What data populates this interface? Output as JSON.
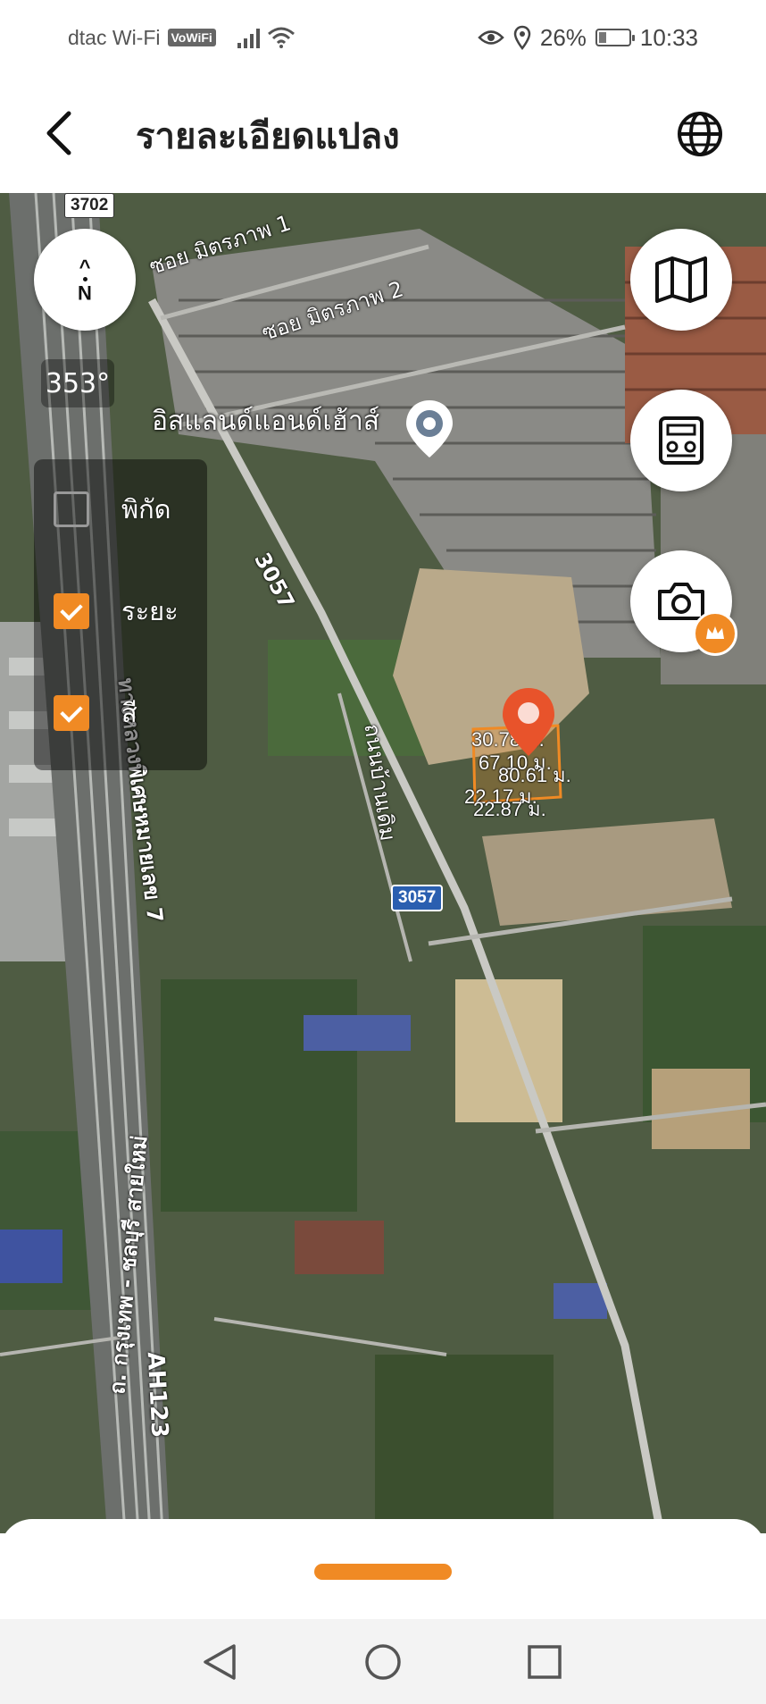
{
  "status_bar": {
    "carrier": "dtac Wi-Fi",
    "vowifi": "VoWiFi",
    "battery_percent": "26%",
    "battery_level": 0.26,
    "time": "10:33"
  },
  "header": {
    "title": "รายละเอียดแปลง"
  },
  "map": {
    "heading": "353°",
    "compass_letter": "N",
    "poi_label": "อิสแลนด์แอนด์เฮ้าส์",
    "roads": {
      "soi_1": "ซอย มิตรภาพ 1",
      "soi_2": "ซอย มิตรภาพ 2",
      "route_3057_label": "3057",
      "highway_7": "ทางหลวงพิเศษหมายเลข 7",
      "krungthep_chonburi": "ถ. กรุงเทพ - ชลบุรี สายใหม่",
      "ah123": "AH123",
      "local_road": "ถนนบ้านเดิม"
    },
    "shields": {
      "route_3702": "3702",
      "route_3057": "3057"
    },
    "layers": [
      {
        "label": "พิกัด",
        "checked": false
      },
      {
        "label": "ระยะ",
        "checked": true
      },
      {
        "label": "สี",
        "checked": true
      }
    ],
    "measurements": {
      "m1": "30.78 ม.",
      "m2": "67.10 ม.",
      "m3": "80.61 ม.",
      "m4": "22.17 ม.",
      "m5": "22.87 ม."
    }
  },
  "colors": {
    "accent": "#f08a24",
    "pin_red": "#e8532b",
    "shield_blue": "#2a5fb0"
  },
  "icons": [
    "back-arrow-icon",
    "globe-icon",
    "map-icon",
    "calculator-icon",
    "camera-icon",
    "crown-icon",
    "location-pin-icon"
  ]
}
